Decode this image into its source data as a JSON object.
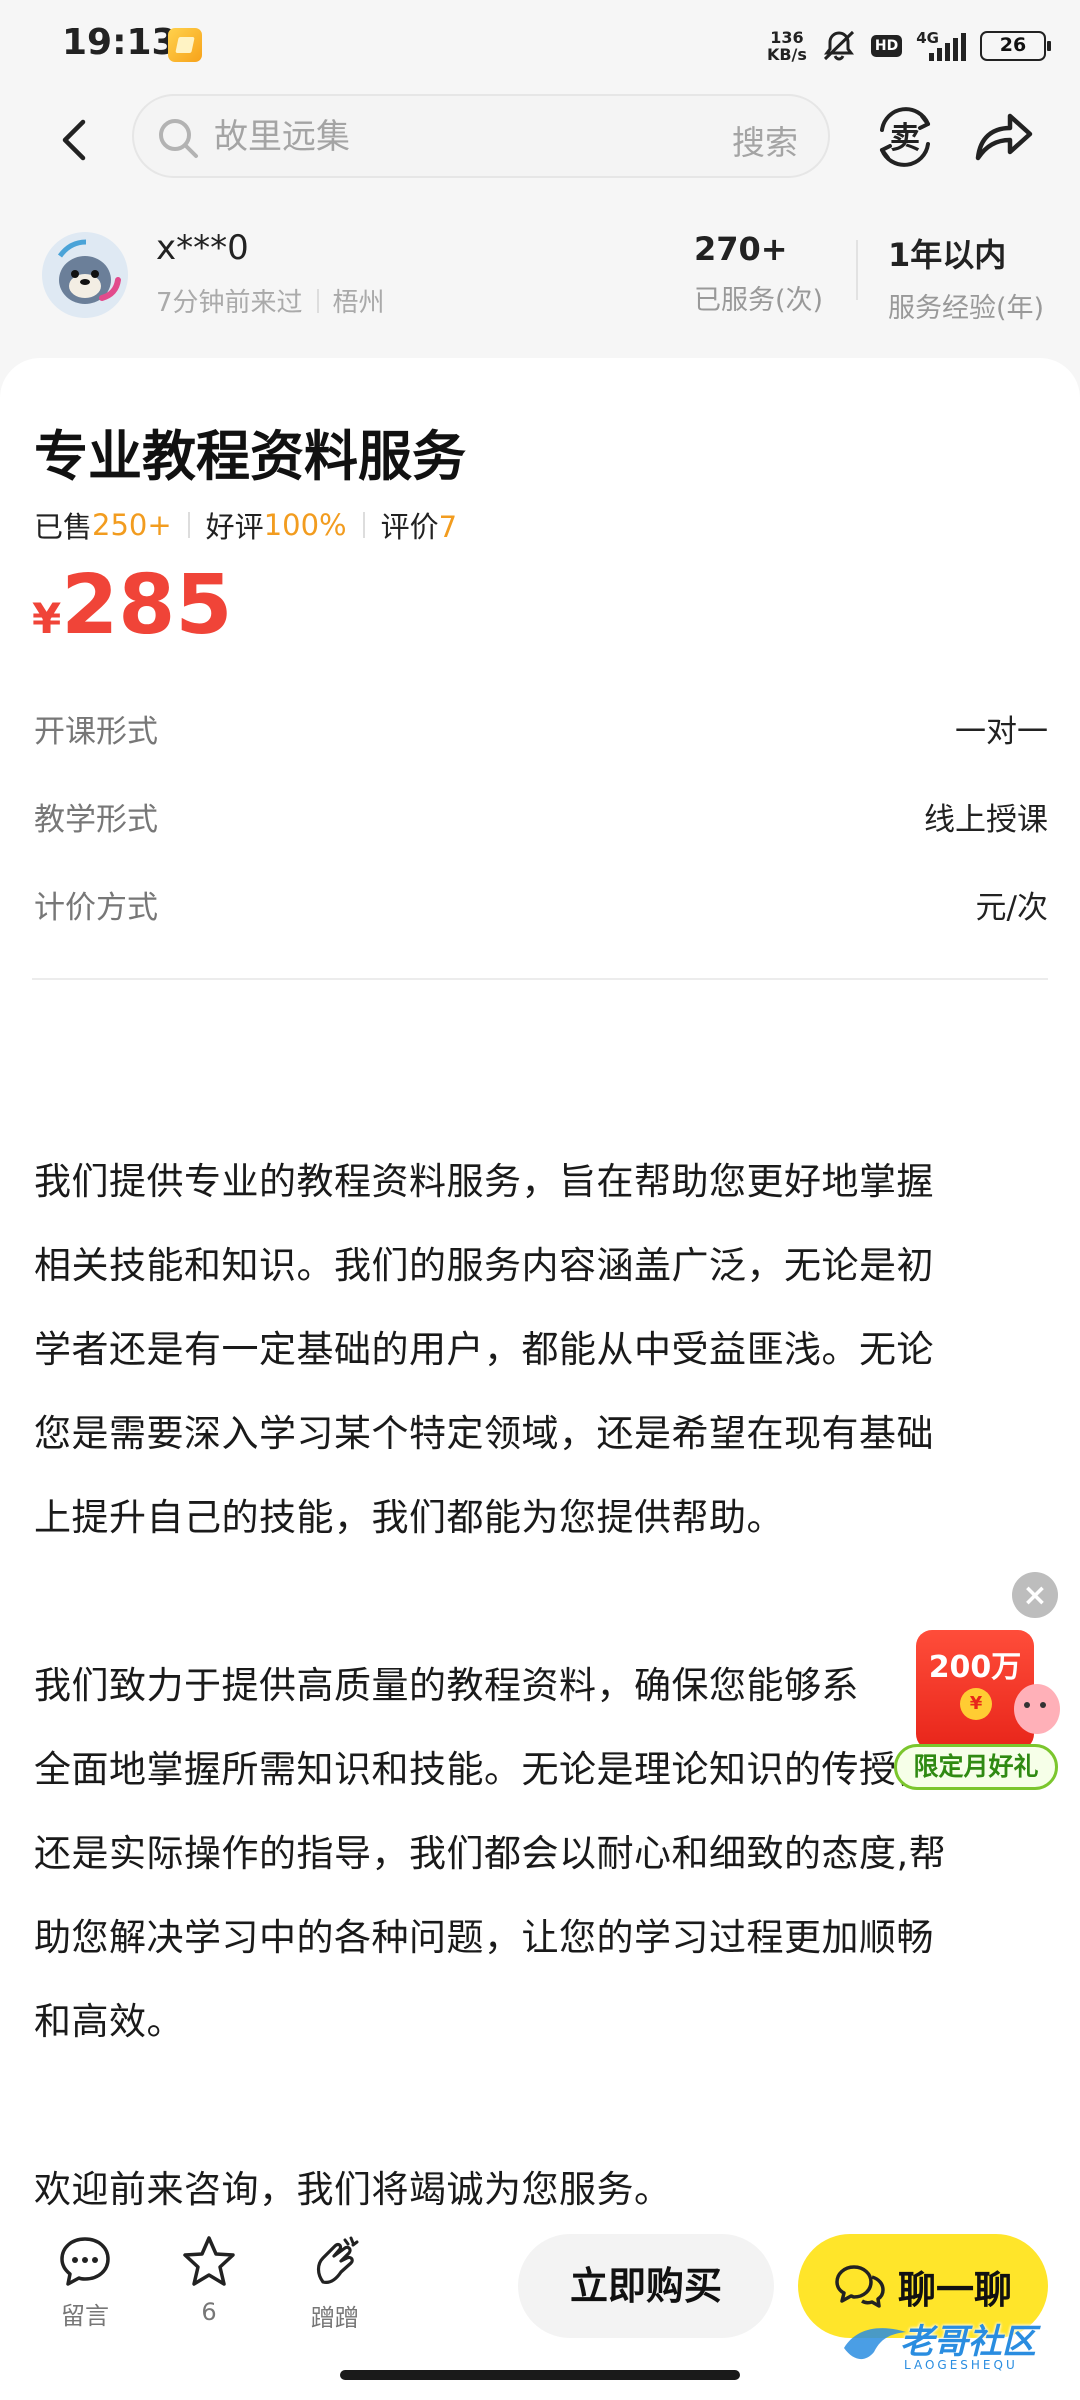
{
  "status_bar": {
    "time": "19:13",
    "net_speed_value": "136",
    "net_speed_unit": "KB/s",
    "hd": "HD",
    "net_type": "4G",
    "battery": "26"
  },
  "nav": {
    "search_placeholder": "故里远集",
    "search_button": "搜索",
    "sell_label": "卖"
  },
  "seller": {
    "name": "x***0",
    "last_seen": "7分钟前来过",
    "city": "梧州",
    "served_value": "270+",
    "served_label": "已服务(次)",
    "experience_value": "1年以内",
    "experience_label": "服务经验(年)"
  },
  "product": {
    "title": "专业教程资料服务",
    "sold_label": "已售",
    "sold_value": "250+",
    "rating_label": "好评",
    "rating_value": "100%",
    "reviews_label": "评价",
    "reviews_value": "7",
    "price_symbol": "¥",
    "price": "285"
  },
  "attributes": [
    {
      "label": "开课形式",
      "value": "一对一"
    },
    {
      "label": "教学形式",
      "value": "线上授课"
    },
    {
      "label": "计价方式",
      "value": "元/次"
    }
  ],
  "description": {
    "p1_lines": [
      "我们提供专业的教程资料服务，旨在帮助您更好地掌握",
      "相关技能和知识。我们的服务内容涵盖广泛，无论是初",
      "学者还是有一定基础的用户，都能从中受益匪浅。无论",
      "您是需要深入学习某个特定领域，还是希望在现有基础",
      "上提升自己的技能，我们都能为您提供帮助。"
    ],
    "p2_lines": [
      "我们致力于提供高质量的教程资料，确保您能够系",
      "全面地掌握所需知识和技能。无论是理论知识的传授，",
      "还是实际操作的指导，我们都会以耐心和细致的态度,帮",
      "助您解决学习中的各种问题，让您的学习过程更加顺畅",
      "和高效。"
    ],
    "p3_line": "欢迎前来咨询，我们将竭诚为您服务。"
  },
  "promo": {
    "amount": "200万",
    "coin": "¥",
    "label": "限定月好礼",
    "close": "×"
  },
  "bottom_bar": {
    "message_label": "留言",
    "favorite_count": "6",
    "pat_label": "蹭蹭",
    "buy_label": "立即购买",
    "chat_label": "聊一聊"
  },
  "watermark": {
    "text": "老哥社区",
    "sub": "LAOGESHEQU"
  },
  "colors": {
    "price_red": "#f04438",
    "highlight_orange": "#f29c1f",
    "chat_yellow": "#ffe52a",
    "promo_green": "#7bc62d"
  }
}
